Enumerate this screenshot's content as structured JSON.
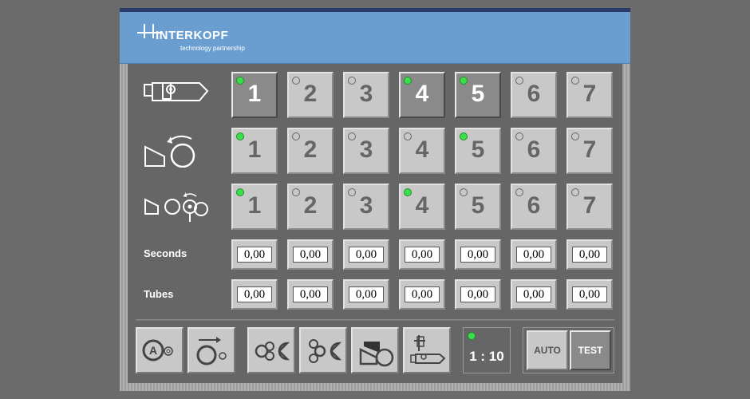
{
  "header": {
    "brand": "INTERKOPF",
    "tagline": "technology partnership"
  },
  "rows": [
    {
      "icon": "cartridge-icon",
      "buttons": [
        {
          "label": "1",
          "selected": true,
          "led": "green"
        },
        {
          "label": "2",
          "selected": false,
          "led": "off"
        },
        {
          "label": "3",
          "selected": false,
          "led": "off"
        },
        {
          "label": "4",
          "selected": true,
          "led": "green"
        },
        {
          "label": "5",
          "selected": true,
          "led": "green"
        },
        {
          "label": "6",
          "selected": false,
          "led": "off"
        },
        {
          "label": "7",
          "selected": false,
          "led": "off"
        }
      ]
    },
    {
      "icon": "rotate-roller-icon",
      "buttons": [
        {
          "label": "1",
          "selected": false,
          "led": "green"
        },
        {
          "label": "2",
          "selected": false,
          "led": "off"
        },
        {
          "label": "3",
          "selected": false,
          "led": "off"
        },
        {
          "label": "4",
          "selected": false,
          "led": "off"
        },
        {
          "label": "5",
          "selected": false,
          "led": "green"
        },
        {
          "label": "6",
          "selected": false,
          "led": "off"
        },
        {
          "label": "7",
          "selected": false,
          "led": "off"
        }
      ]
    },
    {
      "icon": "rollers-transfer-icon",
      "buttons": [
        {
          "label": "1",
          "selected": false,
          "led": "green"
        },
        {
          "label": "2",
          "selected": false,
          "led": "off"
        },
        {
          "label": "3",
          "selected": false,
          "led": "off"
        },
        {
          "label": "4",
          "selected": false,
          "led": "green"
        },
        {
          "label": "5",
          "selected": false,
          "led": "off"
        },
        {
          "label": "6",
          "selected": false,
          "led": "off"
        },
        {
          "label": "7",
          "selected": false,
          "led": "off"
        }
      ]
    }
  ],
  "seconds": {
    "label": "Seconds",
    "values": [
      "0,00",
      "0,00",
      "0,00",
      "0,00",
      "0,00",
      "0,00",
      "0,00"
    ]
  },
  "tubes": {
    "label": "Tubes",
    "values": [
      "0,00",
      "0,00",
      "0,00",
      "0,00",
      "0,00",
      "0,00",
      "0,00"
    ]
  },
  "toolbar": [
    {
      "icon": "auto-roller-icon"
    },
    {
      "icon": "rotate-arrow-roller-icon"
    },
    {
      "icon": "gear-cutter-left-icon"
    },
    {
      "icon": "gear-cutter-right-icon"
    },
    {
      "icon": "feed-unit-icon"
    },
    {
      "icon": "cartridge-clamp-icon"
    }
  ],
  "ratio": {
    "text": "1 : 10",
    "led": "green"
  },
  "modes": {
    "auto": "AUTO",
    "test": "TEST",
    "active": "TEST"
  },
  "colors": {
    "header": "#6a9ed0",
    "panel": "#666666",
    "led_green": "#3ae04a",
    "button": "#c8c8c8",
    "button_selected": "#8a8a8a"
  }
}
